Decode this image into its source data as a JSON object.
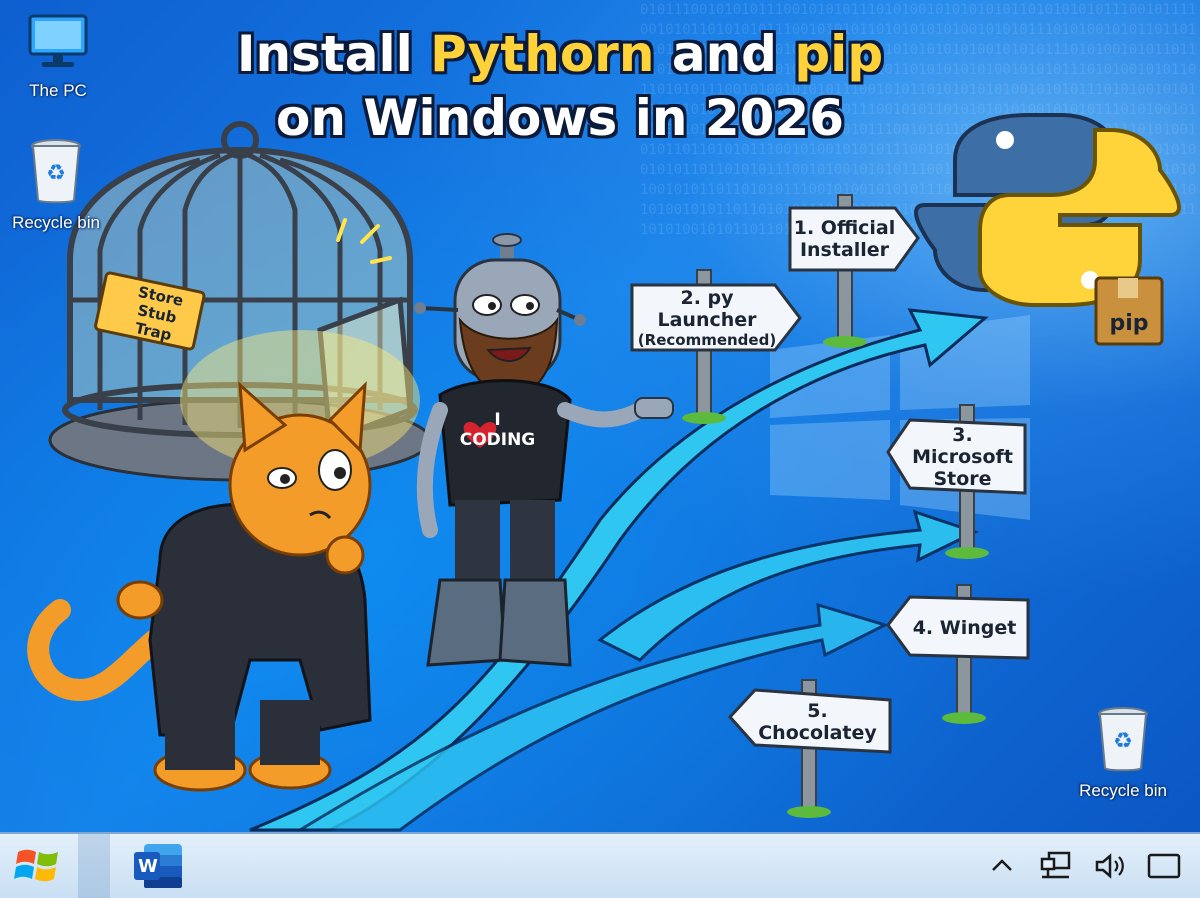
{
  "headline": {
    "t1": "Install ",
    "t2": "Pythorn",
    "t3": " and ",
    "t4": "pip",
    "t5": "on Windows in 2026"
  },
  "desktop_icons": {
    "this_pc": "The PC",
    "recycle_bin_top": "Recycle bin",
    "recycle_bin_bottom": "Recycle bin"
  },
  "cage_sign": {
    "l1": "Store Stub",
    "l2": "Trap"
  },
  "robot_shirt": {
    "l1": "I",
    "l2": "CODING"
  },
  "signs": {
    "s1": {
      "l1": "1. Official",
      "l2": "Installer"
    },
    "s2": {
      "l1": "2. py Launcher",
      "l2": "(Recommended)"
    },
    "s3": {
      "l1": "3. Microsoft",
      "l2": "Store"
    },
    "s4": {
      "l1": "4. Winget"
    },
    "s5": {
      "l1": "5. Chocolatey"
    }
  },
  "pip_box": "pip",
  "taskbar": {
    "word_letter": "W"
  },
  "colors": {
    "accent_yellow": "#ffd23a",
    "python_blue": "#3d6fa6",
    "python_yellow": "#ffd43b",
    "sign_white": "#f3f6fa",
    "arrow_cyan": "#2fc6f2"
  }
}
